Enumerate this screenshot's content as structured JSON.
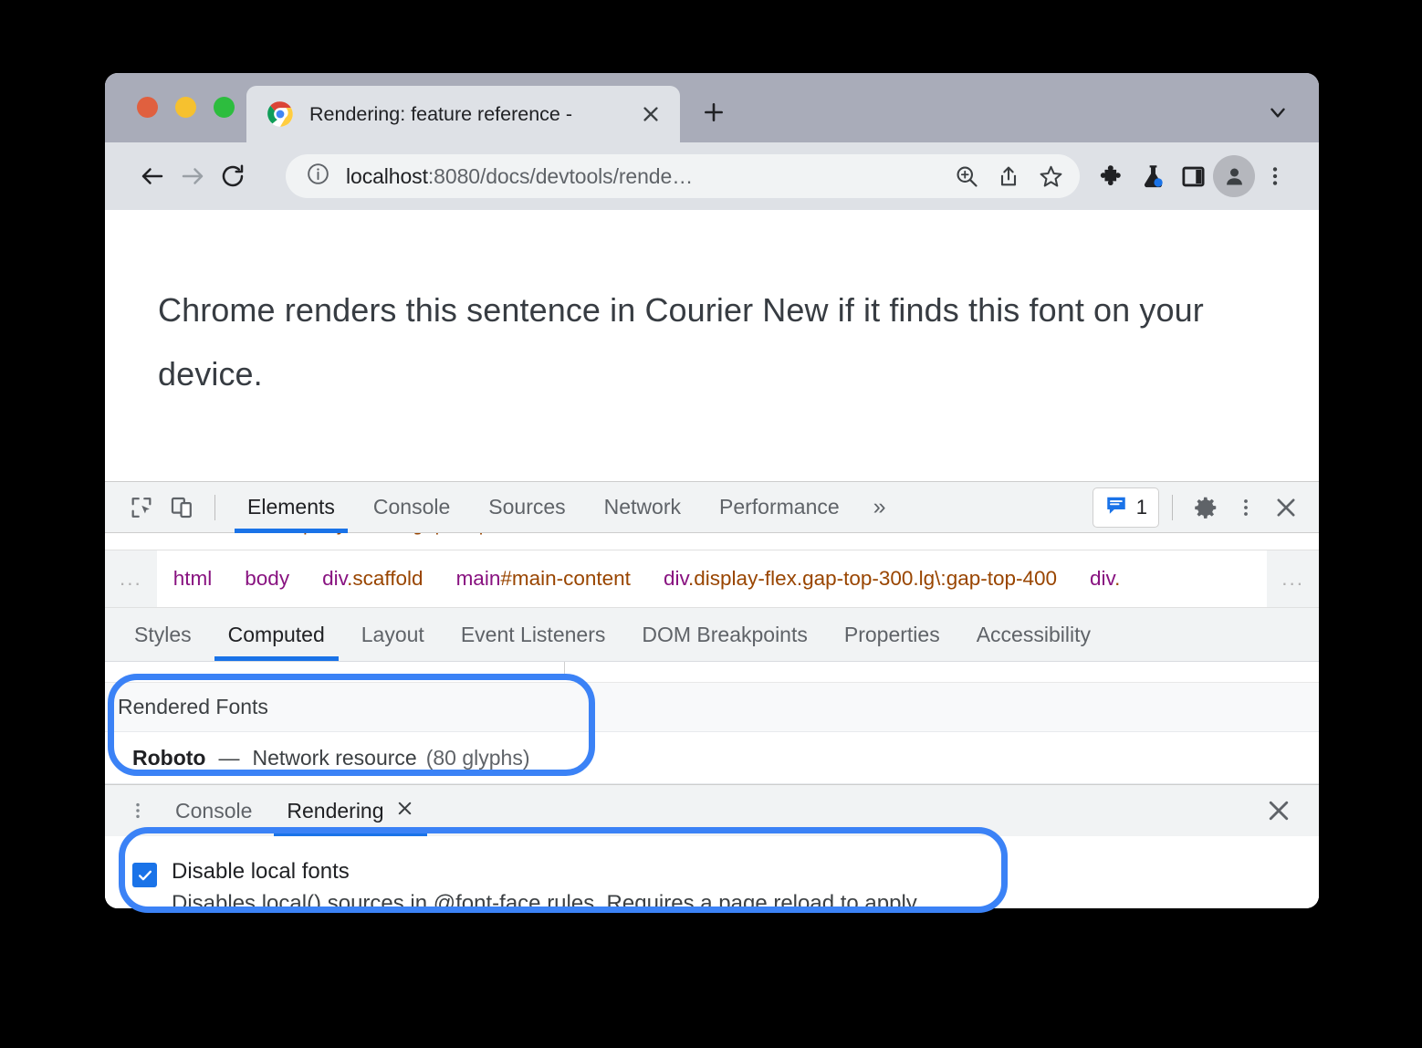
{
  "browser": {
    "traffic_lights": [
      "close",
      "minimize",
      "maximize"
    ],
    "tab": {
      "title": "Rendering: feature reference -",
      "favicon": "chrome-logo-icon",
      "close_icon": "close-icon"
    },
    "new_tab_label": "+",
    "tab_search_icon": "chevron-down-icon",
    "toolbar": {
      "back_icon": "back-arrow-icon",
      "forward_icon": "forward-arrow-icon",
      "reload_icon": "reload-icon",
      "site_info_icon": "info-circle-icon",
      "url_host": "localhost",
      "url_rest": ":8080/docs/devtools/rende…",
      "zoom_icon": "zoom-in-icon",
      "share_icon": "share-icon",
      "bookmark_icon": "star-icon",
      "extensions_icon": "puzzle-piece-icon",
      "experiments_icon": "flask-icon",
      "side_panel_icon": "side-panel-icon",
      "profile_icon": "avatar-icon",
      "menu_icon": "three-dot-menu-icon"
    }
  },
  "page": {
    "sentence": "Chrome renders this sentence in Courier New if it finds this font on your device."
  },
  "devtools": {
    "toolbar": {
      "inspect_icon": "inspect-element-icon",
      "device_toolbar_icon": "device-toolbar-icon",
      "tabs": [
        {
          "label": "Elements",
          "active": true
        },
        {
          "label": "Console",
          "active": false
        },
        {
          "label": "Sources",
          "active": false
        },
        {
          "label": "Network",
          "active": false
        },
        {
          "label": "Performance",
          "active": false
        }
      ],
      "more_tabs_icon": "»",
      "issues_icon": "issues-speech-bubble-icon",
      "issues_count": "1",
      "settings_icon": "gear-icon",
      "more_options_icon": "three-dot-menu-icon",
      "close_icon": "close-icon"
    },
    "breadcrumbs": {
      "overflow_left": "...",
      "overflow_right": "...",
      "items": [
        {
          "tag": "html",
          "cls": ""
        },
        {
          "tag": "body",
          "cls": ""
        },
        {
          "tag": "div",
          "cls": ".scaffold"
        },
        {
          "tag": "main",
          "cls": "#main-content"
        },
        {
          "tag": "div",
          "cls": ".display-flex.gap-top-300.lg\\:gap-top-400"
        },
        {
          "tag": "div",
          "cls": "."
        }
      ]
    },
    "sidebar_tabs": [
      {
        "label": "Styles",
        "active": false
      },
      {
        "label": "Computed",
        "active": true
      },
      {
        "label": "Layout",
        "active": false
      },
      {
        "label": "Event Listeners",
        "active": false
      },
      {
        "label": "DOM Breakpoints",
        "active": false
      },
      {
        "label": "Properties",
        "active": false
      },
      {
        "label": "Accessibility",
        "active": false
      }
    ],
    "rendered_fonts": {
      "section_title": "Rendered Fonts",
      "font_name": "Roboto",
      "separator": "—",
      "source": "Network resource",
      "glyphs": "(80 glyphs)"
    },
    "drawer": {
      "more_icon": "three-dot-menu-icon",
      "tabs": [
        {
          "label": "Console",
          "active": false,
          "closable": false
        },
        {
          "label": "Rendering",
          "active": true,
          "closable": true
        }
      ],
      "tab_close_icon": "close-icon",
      "close_icon": "close-icon",
      "settings": [
        {
          "title": "Disable local fonts",
          "description": "Disables local() sources in @font-face rules. Requires a page reload to apply.",
          "checked": true
        }
      ]
    }
  },
  "annotations": {
    "highlight_color": "#3b82f6",
    "regions": [
      "rendered-fonts-section",
      "disable-local-fonts-setting"
    ]
  }
}
